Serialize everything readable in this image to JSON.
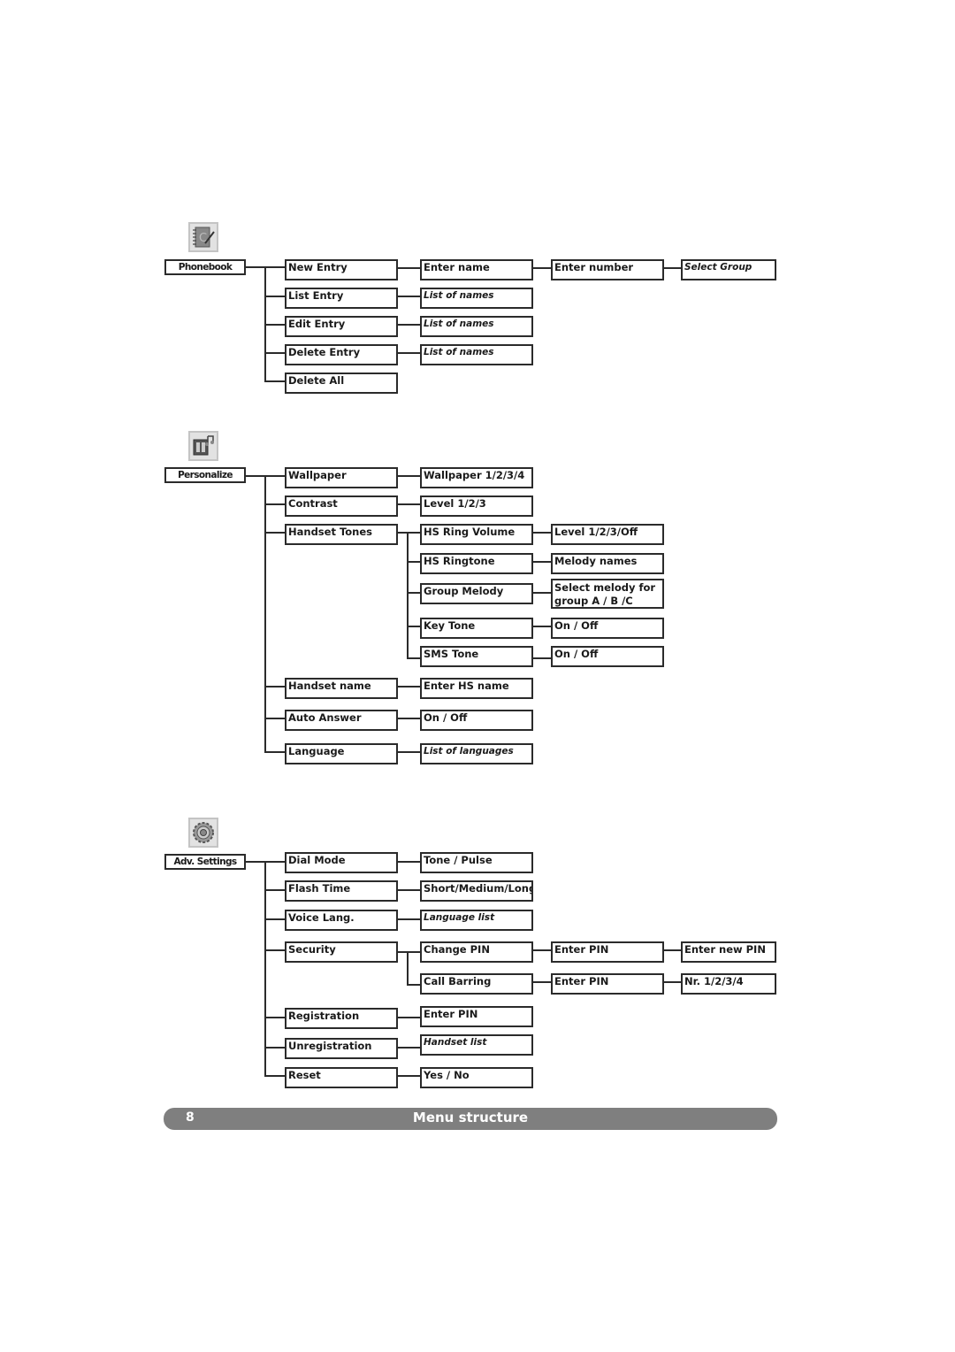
{
  "sections": {
    "phonebook": {
      "title": "Phonebook",
      "icon": "phonebook-notepad-icon",
      "items": [
        {
          "label": "New Entry",
          "next": [
            "Enter name",
            "Enter number",
            "Select Group"
          ]
        },
        {
          "label": "List Entry",
          "next": [
            "List of names"
          ]
        },
        {
          "label": "Edit Entry",
          "next": [
            "List of names"
          ]
        },
        {
          "label": "Delete Entry",
          "next": [
            "List of names"
          ]
        },
        {
          "label": "Delete All",
          "next": []
        }
      ]
    },
    "personalize": {
      "title": "Personalize",
      "icon": "personalize-display-music-icon",
      "items": [
        {
          "label": "Wallpaper",
          "next": [
            "Wallpaper 1/2/3/4"
          ]
        },
        {
          "label": "Contrast",
          "next": [
            "Level 1/2/3"
          ]
        },
        {
          "label": "Handset Tones",
          "children": [
            {
              "label": "HS Ring Volume",
              "next": "Level 1/2/3/Off"
            },
            {
              "label": "HS Ringtone",
              "next": "Melody names"
            },
            {
              "label": "Group Melody",
              "next": "Select melody for group A / B /C"
            },
            {
              "label": "Key Tone",
              "next": "On / Off"
            },
            {
              "label": "SMS Tone",
              "next": "On / Off"
            }
          ]
        },
        {
          "label": "Handset name",
          "next": [
            "Enter HS name"
          ]
        },
        {
          "label": "Auto Answer",
          "next": [
            "On / Off"
          ]
        },
        {
          "label": "Language",
          "next": [
            "List of languages"
          ]
        }
      ]
    },
    "adv_settings": {
      "title": "Adv. Settings",
      "icon": "settings-gear-icon",
      "items": [
        {
          "label": "Dial Mode",
          "next": [
            "Tone / Pulse"
          ]
        },
        {
          "label": "Flash Time",
          "next": [
            "Short/Medium/Long"
          ]
        },
        {
          "label": "Voice Lang.",
          "next": [
            "Language list"
          ]
        },
        {
          "label": "Security",
          "children": [
            {
              "label": "Change PIN",
              "next": [
                "Enter PIN",
                "Enter new PIN"
              ]
            },
            {
              "label": "Call Barring",
              "next": [
                "Enter PIN",
                "Nr. 1/2/3/4"
              ]
            }
          ]
        },
        {
          "label": "Registration",
          "next": [
            "Enter PIN"
          ]
        },
        {
          "label": "Unregistration",
          "next": [
            "Handset list"
          ]
        },
        {
          "label": "Reset",
          "next": [
            "Yes / No"
          ]
        }
      ]
    }
  },
  "footer": {
    "page_number": "8",
    "title": "Menu structure"
  }
}
